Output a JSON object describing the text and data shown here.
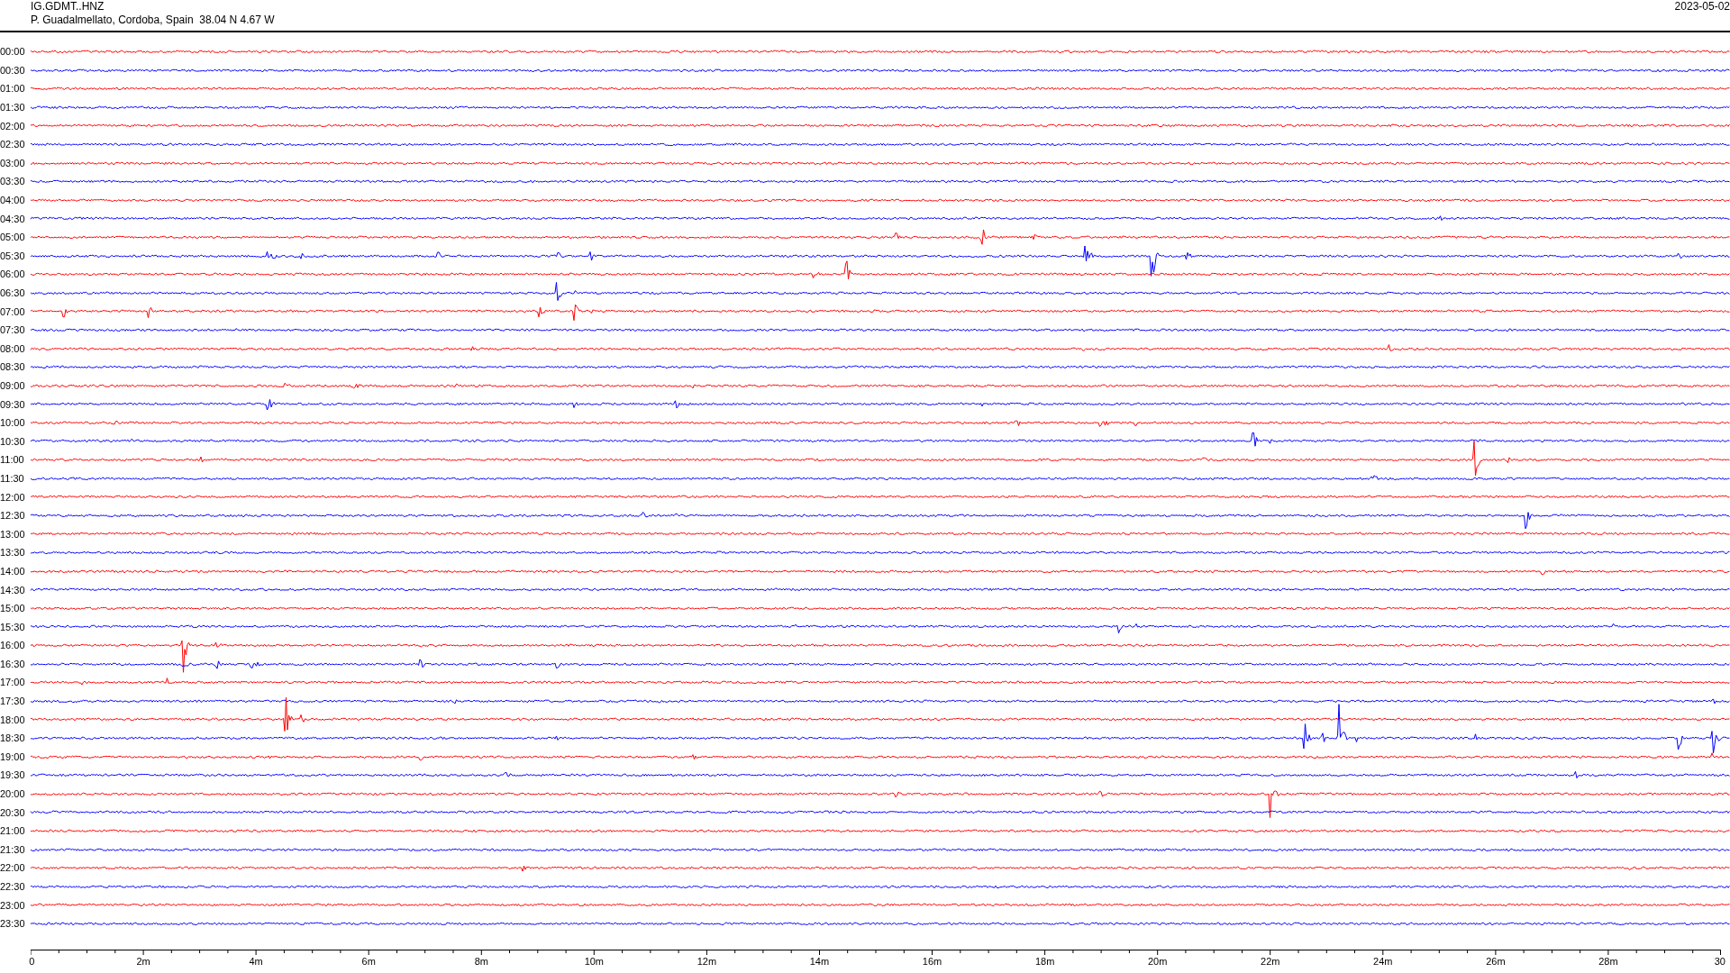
{
  "header": {
    "station": "IG.GDMT..HNZ",
    "location": "P. Guadalmellato, Cordoba, Spain  38.04 N 4.67 W",
    "date": "2023-05-02"
  },
  "traces": [
    {
      "label": "00:00",
      "color": "#ff0000"
    },
    {
      "label": "00:30",
      "color": "#0000ff"
    },
    {
      "label": "01:00",
      "color": "#ff0000"
    },
    {
      "label": "01:30",
      "color": "#0000ff"
    },
    {
      "label": "02:00",
      "color": "#ff0000"
    },
    {
      "label": "02:30",
      "color": "#0000ff"
    },
    {
      "label": "03:00",
      "color": "#ff0000"
    },
    {
      "label": "03:30",
      "color": "#0000ff"
    },
    {
      "label": "04:00",
      "color": "#ff0000"
    },
    {
      "label": "04:30",
      "color": "#0000ff"
    },
    {
      "label": "05:00",
      "color": "#ff0000"
    },
    {
      "label": "05:30",
      "color": "#0000ff"
    },
    {
      "label": "06:00",
      "color": "#ff0000"
    },
    {
      "label": "06:30",
      "color": "#0000ff"
    },
    {
      "label": "07:00",
      "color": "#ff0000"
    },
    {
      "label": "07:30",
      "color": "#0000ff"
    },
    {
      "label": "08:00",
      "color": "#ff0000"
    },
    {
      "label": "08:30",
      "color": "#0000ff"
    },
    {
      "label": "09:00",
      "color": "#ff0000"
    },
    {
      "label": "09:30",
      "color": "#0000ff"
    },
    {
      "label": "10:00",
      "color": "#ff0000"
    },
    {
      "label": "10:30",
      "color": "#0000ff"
    },
    {
      "label": "11:00",
      "color": "#ff0000"
    },
    {
      "label": "11:30",
      "color": "#0000ff"
    },
    {
      "label": "12:00",
      "color": "#ff0000"
    },
    {
      "label": "12:30",
      "color": "#0000ff"
    },
    {
      "label": "13:00",
      "color": "#ff0000"
    },
    {
      "label": "13:30",
      "color": "#0000ff"
    },
    {
      "label": "14:00",
      "color": "#ff0000"
    },
    {
      "label": "14:30",
      "color": "#0000ff"
    },
    {
      "label": "15:00",
      "color": "#ff0000"
    },
    {
      "label": "15:30",
      "color": "#0000ff"
    },
    {
      "label": "16:00",
      "color": "#ff0000"
    },
    {
      "label": "16:30",
      "color": "#0000ff"
    },
    {
      "label": "17:00",
      "color": "#ff0000"
    },
    {
      "label": "17:30",
      "color": "#0000ff"
    },
    {
      "label": "18:00",
      "color": "#ff0000"
    },
    {
      "label": "18:30",
      "color": "#0000ff"
    },
    {
      "label": "19:00",
      "color": "#ff0000"
    },
    {
      "label": "19:30",
      "color": "#0000ff"
    },
    {
      "label": "20:00",
      "color": "#ff0000"
    },
    {
      "label": "20:30",
      "color": "#0000ff"
    },
    {
      "label": "21:00",
      "color": "#ff0000"
    },
    {
      "label": "21:30",
      "color": "#0000ff"
    },
    {
      "label": "22:00",
      "color": "#ff0000"
    },
    {
      "label": "22:30",
      "color": "#0000ff"
    },
    {
      "label": "23:00",
      "color": "#ff0000"
    },
    {
      "label": "23:30",
      "color": "#0000ff"
    }
  ],
  "axis": {
    "labels": [
      "0",
      "2m",
      "4m",
      "6m",
      "8m",
      "10m",
      "12m",
      "14m",
      "16m",
      "18m",
      "20m",
      "22m",
      "24m",
      "26m",
      "28m",
      "30"
    ]
  }
}
